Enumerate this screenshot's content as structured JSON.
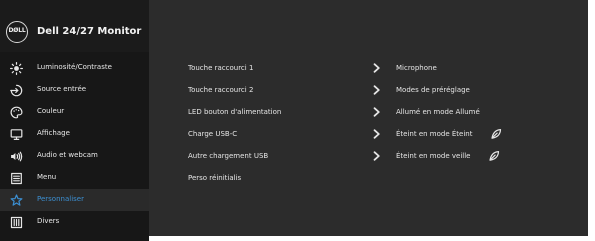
{
  "osd": {
    "brand": {
      "logo_text": "DØLL",
      "title": "Dell 24/27 Monitor"
    },
    "menu": [
      {
        "label": "Luminosité/Contraste",
        "icon": "brightness-icon",
        "selected": false
      },
      {
        "label": "Source entrée",
        "icon": "input-source-icon",
        "selected": false
      },
      {
        "label": "Couleur",
        "icon": "color-palette-icon",
        "selected": false
      },
      {
        "label": "Affichage",
        "icon": "display-icon",
        "selected": false
      },
      {
        "label": "Audio et webcam",
        "icon": "audio-webcam-icon",
        "selected": false
      },
      {
        "label": "Menu",
        "icon": "menu-icon",
        "selected": false
      },
      {
        "label": "Personnaliser",
        "icon": "star-icon",
        "selected": true
      },
      {
        "label": "Divers",
        "icon": "others-icon",
        "selected": false
      }
    ],
    "settings": [
      {
        "label": "Touche raccourci 1",
        "value": "Microphone",
        "has_chevron": true,
        "leaf": false
      },
      {
        "label": "Touche raccourci 2",
        "value": "Modes de préréglage",
        "has_chevron": true,
        "leaf": false
      },
      {
        "label": "LED bouton d'alimentation",
        "value": "Allumé en mode Allumé",
        "has_chevron": true,
        "leaf": false
      },
      {
        "label": "Charge USB-C",
        "value": "Éteint en mode Éteint",
        "has_chevron": true,
        "leaf": true
      },
      {
        "label": "Autre chargement USB",
        "value": "Éteint en mode veille",
        "has_chevron": true,
        "leaf": true
      },
      {
        "label": "Perso réinitialis",
        "value": "",
        "has_chevron": false,
        "leaf": false
      }
    ],
    "colors": {
      "sidebar": "#171717",
      "content": "#2c2c2c",
      "selected_text": "#3c8fd1",
      "text": "#e6e6e6"
    }
  }
}
